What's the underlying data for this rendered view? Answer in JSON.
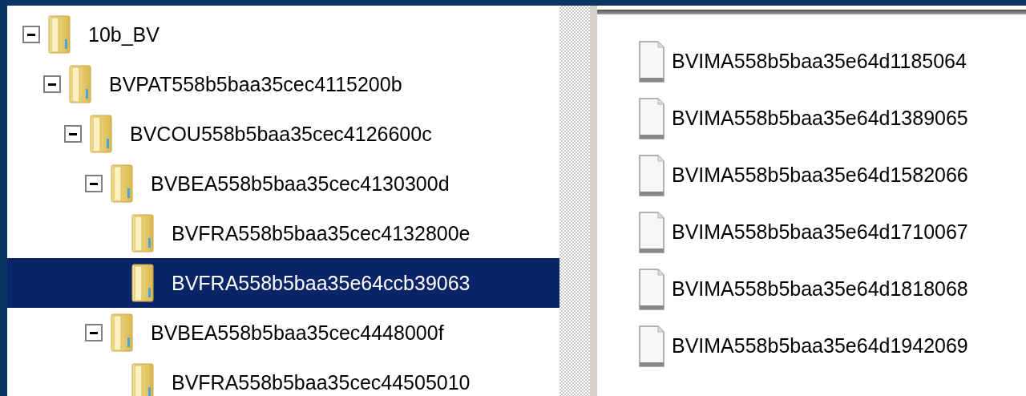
{
  "tree": [
    {
      "label": "10b_BV",
      "expanded": true,
      "selected": false,
      "children": [
        {
          "label": "BVPAT558b5baa35cec4115200b",
          "expanded": true,
          "selected": false,
          "children": [
            {
              "label": "BVCOU558b5baa35cec4126600c",
              "expanded": true,
              "selected": false,
              "children": [
                {
                  "label": "BVBEA558b5baa35cec4130300d",
                  "expanded": true,
                  "selected": false,
                  "children": [
                    {
                      "label": "BVFRA558b5baa35cec4132800e",
                      "selected": false
                    },
                    {
                      "label": "BVFRA558b5baa35e64ccb39063",
                      "selected": true
                    }
                  ]
                },
                {
                  "label": "BVBEA558b5baa35cec4448000f",
                  "expanded": true,
                  "selected": false,
                  "children": [
                    {
                      "label": "BVFRA558b5baa35cec44505010",
                      "selected": false
                    }
                  ]
                }
              ]
            }
          ]
        }
      ]
    }
  ],
  "files": [
    {
      "name": "BVIMA558b5baa35e64d1185064"
    },
    {
      "name": "BVIMA558b5baa35e64d1389065"
    },
    {
      "name": "BVIMA558b5baa35e64d1582066"
    },
    {
      "name": "BVIMA558b5baa35e64d1710067"
    },
    {
      "name": "BVIMA558b5baa35e64d1818068"
    },
    {
      "name": "BVIMA558b5baa35e64d1942069"
    }
  ]
}
